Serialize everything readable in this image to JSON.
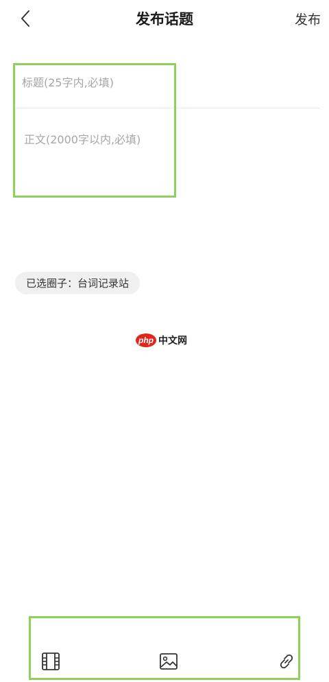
{
  "header": {
    "title": "发布话题",
    "publish_label": "发布",
    "back_icon": "chevron-left-icon"
  },
  "form": {
    "title_placeholder": "标题(25字内,必填)",
    "body_placeholder": "正文(2000字以内,必填)"
  },
  "circle": {
    "label": "已选圈子：台词记录站"
  },
  "watermark": {
    "left": "php",
    "right": "中文网"
  },
  "toolbar": {
    "icons": [
      "video-icon",
      "image-icon",
      "link-icon"
    ]
  },
  "colors": {
    "highlight": "#8fd05b",
    "placeholder": "#a6a6a6",
    "chip_bg": "#f0f0f0",
    "watermark_red": "#e1251b"
  }
}
